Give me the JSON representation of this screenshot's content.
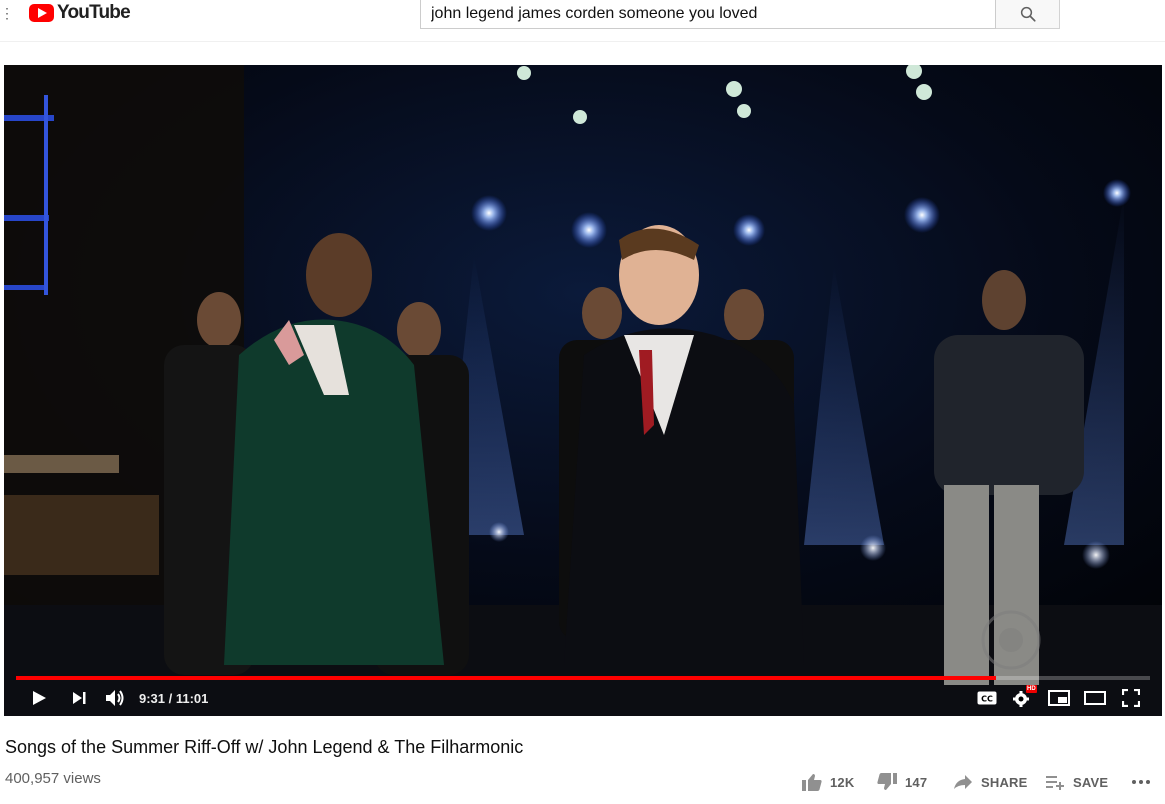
{
  "masthead": {
    "logo_text": "YouTube",
    "search": {
      "value": "john legend james corden someone you loved",
      "placeholder": "Search"
    }
  },
  "player": {
    "current_time": "9:31",
    "duration": "11:01",
    "time_display": "9:31 / 11:01",
    "progress_fraction": 0.864,
    "accent_color": "#ff0000",
    "badge": "HD"
  },
  "video": {
    "title": "Songs of the Summer Riff-Off w/ John Legend & The Filharmonic",
    "views": "400,957 views"
  },
  "actions": {
    "like": {
      "icon": "thumbs-up-icon",
      "label": "12K"
    },
    "dislike": {
      "icon": "thumbs-down-icon",
      "label": "147"
    },
    "share": {
      "icon": "share-icon",
      "label": "SHARE"
    },
    "save": {
      "icon": "playlist-add-icon",
      "label": "SAVE"
    },
    "more": {
      "icon": "more-icon"
    }
  }
}
